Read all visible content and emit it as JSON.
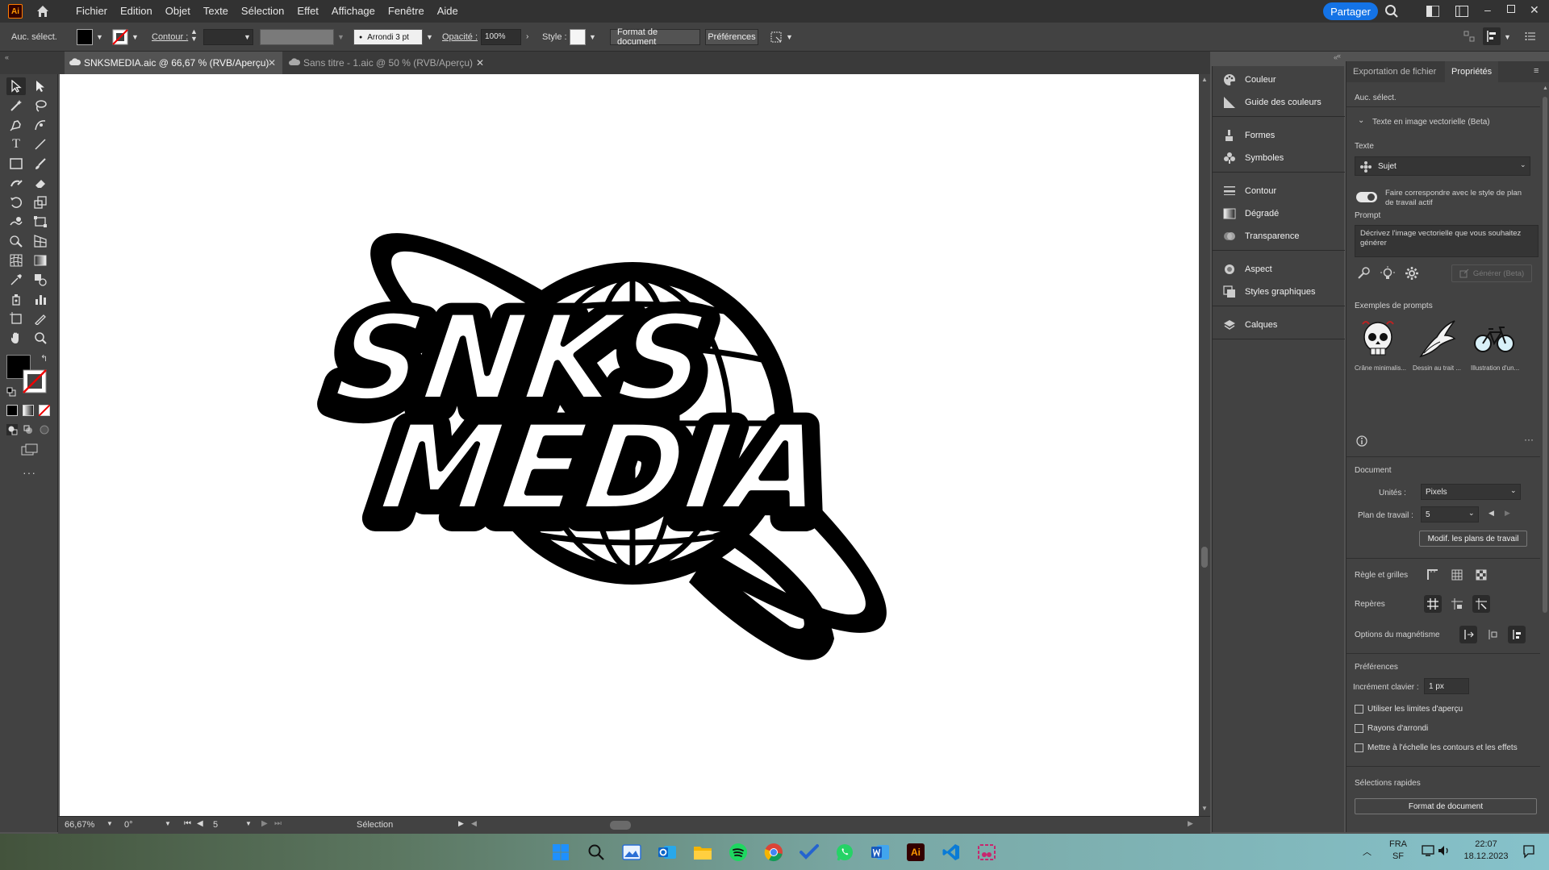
{
  "app": {
    "logo_text": "Ai",
    "share_label": "Partager"
  },
  "menu": [
    "Fichier",
    "Edition",
    "Objet",
    "Texte",
    "Sélection",
    "Effet",
    "Affichage",
    "Fenêtre",
    "Aide"
  ],
  "control_bar": {
    "selection_label": "Auc. sélect.",
    "stroke_label": "Contour :",
    "brush_value": "Arrondi 3 pt",
    "opacity_label": "Opacité :",
    "opacity_value": "100%",
    "style_label": "Style :",
    "doc_format_btn": "Format de document",
    "preferences_btn": "Préférences"
  },
  "tabs": [
    {
      "label": "SNKSMEDIA.aic @ 66,67 % (RVB/Aperçu)",
      "active": true
    },
    {
      "label": "Sans titre - 1.aic @ 50 % (RVB/Aperçu)",
      "active": false
    }
  ],
  "artwork": {
    "line1": "SNKS",
    "line2": "MEDIA"
  },
  "status_bar": {
    "zoom": "66,67%",
    "rotation": "0°",
    "artboard_num": "5",
    "tool": "Sélection"
  },
  "dock": {
    "items": [
      "Couleur",
      "Guide des couleurs",
      "Formes",
      "Symboles",
      "Contour",
      "Dégradé",
      "Transparence",
      "Aspect",
      "Styles graphiques",
      "Calques"
    ]
  },
  "properties": {
    "tab_export": "Exportation de fichier",
    "tab_props": "Propriétés",
    "no_selection": "Auc. sélect.",
    "text_to_vector": "Texte en image vectorielle (Beta)",
    "text_label": "Texte",
    "subject_value": "Sujet",
    "match_style": "Faire correspondre avec le style de plan de travail actif",
    "prompt_label": "Prompt",
    "prompt_placeholder": "Décrivez l'image vectorielle que vous souhaitez générer",
    "generate_btn": "Générer (Beta)",
    "examples_label": "Exemples de prompts",
    "examples": [
      "Crâne minimalis...",
      "Dessin au trait ...",
      "Illustration d'un..."
    ],
    "document_label": "Document",
    "units_label": "Unités :",
    "units_value": "Pixels",
    "artboard_label": "Plan de travail :",
    "artboard_value": "5",
    "edit_artboards_btn": "Modif. les plans de travail",
    "rulers_label": "Règle et grilles",
    "guides_label": "Repères",
    "snap_label": "Options du magnétisme",
    "prefs_label": "Préférences",
    "keyboard_inc_label": "Incrément clavier :",
    "keyboard_inc_value": "1 px",
    "chk_preview_bounds": "Utiliser les limites d'aperçu",
    "chk_corner_radius": "Rayons d'arrondi",
    "chk_scale_strokes": "Mettre à l'échelle les contours et les effets",
    "quick_actions_label": "Sélections rapides",
    "quick_doc_format_btn": "Format de document"
  },
  "taskbar": {
    "lang": "FRA",
    "lang2": "SF",
    "time": "22:07",
    "date": "18.12.2023"
  }
}
